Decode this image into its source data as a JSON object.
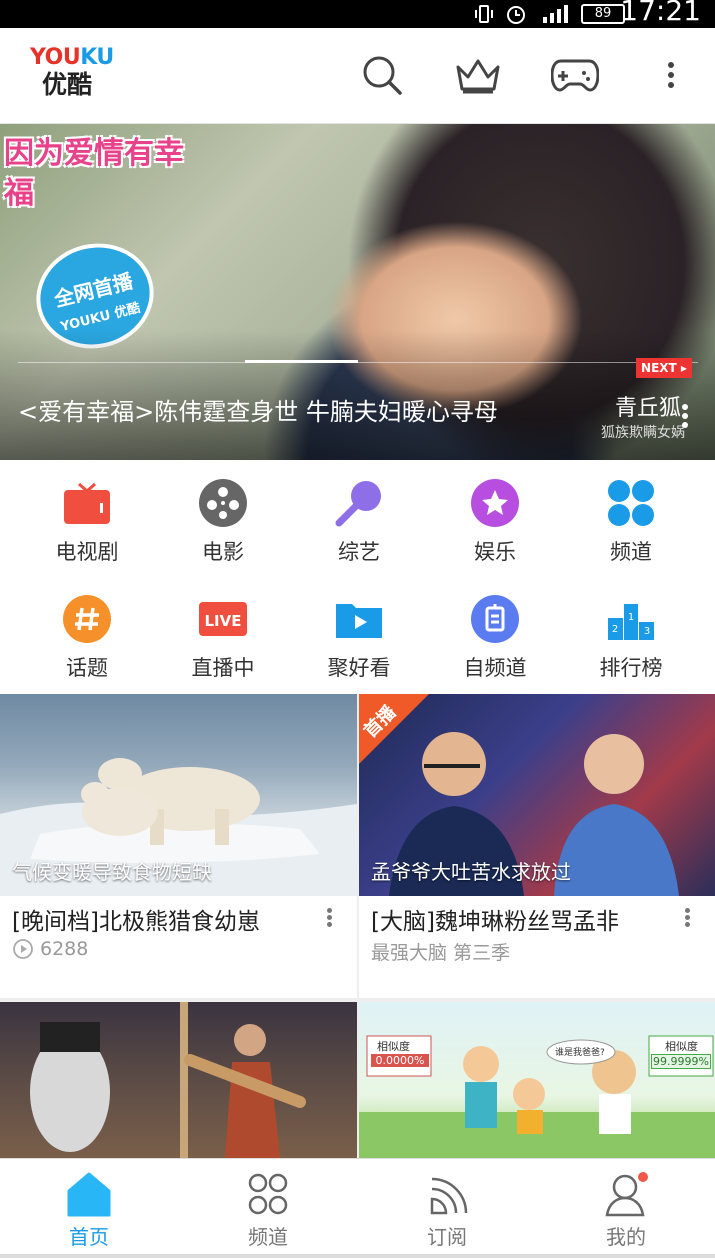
{
  "status_bar": {
    "time": "17:21",
    "battery": "89"
  },
  "header": {
    "logo_en_red": "YOU",
    "logo_en_blue": "KU",
    "logo_cn": "优酷",
    "icons": [
      "search-icon",
      "vip-crown-icon",
      "game-controller-icon",
      "more-vertical-icon"
    ]
  },
  "banner": {
    "show_logo_text": "因为爱情有幸福",
    "badge_main": "全网首播",
    "badge_sub": "YOUKU 优酷",
    "caption": "<爱有幸福>陈伟霆查身世 牛腩夫妇暖心寻母",
    "next_label": "NEXT",
    "preview_title": "青丘狐",
    "preview_sub": "狐族欺瞒女娲"
  },
  "grid": [
    {
      "label": "电视剧",
      "icon": "tv-icon",
      "color": "#f04e3e"
    },
    {
      "label": "电影",
      "icon": "film-reel-icon",
      "color": "#666666"
    },
    {
      "label": "综艺",
      "icon": "microphone-icon",
      "color": "#8e6fe8"
    },
    {
      "label": "娱乐",
      "icon": "star-icon",
      "color": "#b74ee0"
    },
    {
      "label": "频道",
      "icon": "channels-grid-icon",
      "color": "#1a9be8"
    },
    {
      "label": "话题",
      "icon": "hashtag-icon",
      "color": "#f5902a"
    },
    {
      "label": "直播中",
      "icon": "live-icon",
      "color": "#f04e3e"
    },
    {
      "label": "聚好看",
      "icon": "play-folder-icon",
      "color": "#1a9be8"
    },
    {
      "label": "自频道",
      "icon": "self-channel-icon",
      "color": "#5a7cf0"
    },
    {
      "label": "排行榜",
      "icon": "podium-icon",
      "color": "#1a9be8"
    }
  ],
  "cards": [
    {
      "caption": "气候变暖导致食物短缺",
      "title": "[晚间档]北极熊猎食幼崽",
      "sub": "6288",
      "sub_has_play_icon": true,
      "badge": ""
    },
    {
      "caption": "孟爷爷大吐苦水求放过",
      "title": "[大脑]魏坤琳粉丝骂孟非",
      "sub": "最强大脑 第三季",
      "sub_has_play_icon": false,
      "badge": "首播"
    }
  ],
  "cards_row2": [
    {
      "labels": []
    },
    {
      "labels": [
        "相似度",
        "0.0000%",
        "谁是我爸爸?",
        "相似度",
        "99.9999%"
      ]
    }
  ],
  "tabbar": [
    {
      "label": "首页",
      "icon": "home-icon",
      "active": true
    },
    {
      "label": "频道",
      "icon": "channels-icon",
      "active": false
    },
    {
      "label": "订阅",
      "icon": "subscribe-icon",
      "active": false
    },
    {
      "label": "我的",
      "icon": "profile-icon",
      "active": false
    }
  ],
  "colors": {
    "accent": "#1a9be8",
    "brand_red": "#e6332a"
  }
}
